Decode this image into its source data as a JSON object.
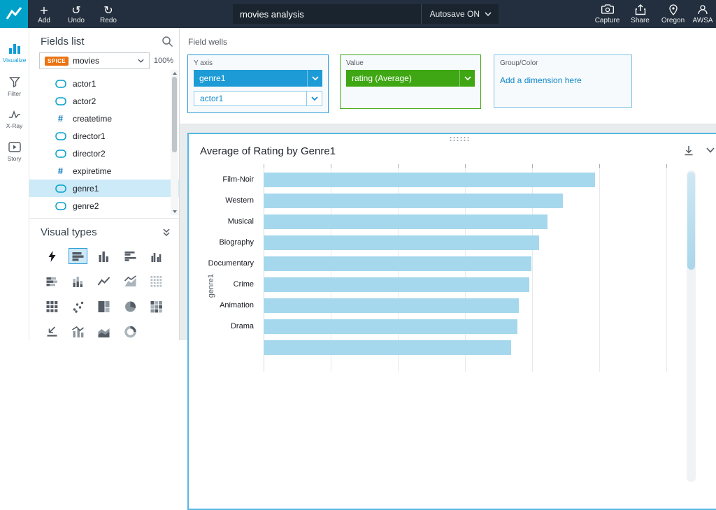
{
  "colors": {
    "accent_blue": "#1d9bd6",
    "accent_green": "#3ea713",
    "bar_fill": "#a5d8ec",
    "spice_badge": "#ec7211",
    "logo_teal": "#00a1c9",
    "link_blue": "#0f87c9"
  },
  "header": {
    "actions": [
      {
        "id": "add",
        "label": "Add"
      },
      {
        "id": "undo",
        "label": "Undo"
      },
      {
        "id": "redo",
        "label": "Redo"
      }
    ],
    "analysis_title": "movies analysis",
    "autosave_label": "Autosave ON",
    "right_actions": [
      {
        "id": "capture",
        "label": "Capture"
      },
      {
        "id": "share",
        "label": "Share"
      },
      {
        "id": "region",
        "label": "Oregon"
      },
      {
        "id": "account",
        "label": "AWSA"
      }
    ]
  },
  "nav_rail": {
    "items": [
      {
        "id": "visualize",
        "label": "Visualize",
        "active": true
      },
      {
        "id": "filter",
        "label": "Filter",
        "active": false
      },
      {
        "id": "xray",
        "label": "X-Ray",
        "active": false
      },
      {
        "id": "story",
        "label": "Story",
        "active": false
      }
    ]
  },
  "fields_panel": {
    "title": "Fields list",
    "dataset_badge": "SPICE",
    "dataset_name": "movies",
    "zoom_level": "100%",
    "fields": [
      {
        "name": "actor1",
        "type": "dimension"
      },
      {
        "name": "actor2",
        "type": "dimension"
      },
      {
        "name": "createtime",
        "type": "numeric"
      },
      {
        "name": "director1",
        "type": "dimension"
      },
      {
        "name": "director2",
        "type": "dimension"
      },
      {
        "name": "expiretime",
        "type": "numeric"
      },
      {
        "name": "genre1",
        "type": "dimension",
        "selected": true
      },
      {
        "name": "genre2",
        "type": "dimension"
      }
    ],
    "visual_types_title": "Visual types",
    "visual_types": [
      {
        "name": "auto-graph"
      },
      {
        "name": "horizontal-bar-chart",
        "selected": true
      },
      {
        "name": "vertical-bar-chart"
      },
      {
        "name": "horizontal-grouped-bar"
      },
      {
        "name": "vertical-grouped-bar"
      },
      {
        "name": "horizontal-stacked-bar"
      },
      {
        "name": "vertical-stacked-bar"
      },
      {
        "name": "line-chart"
      },
      {
        "name": "area-line-chart"
      },
      {
        "name": "pivot-table-light"
      },
      {
        "name": "pivot-table"
      },
      {
        "name": "scatter-plot"
      },
      {
        "name": "tree-map"
      },
      {
        "name": "pie-chart"
      },
      {
        "name": "heat-map"
      },
      {
        "name": "kpi"
      },
      {
        "name": "combo-bar-line"
      },
      {
        "name": "stacked-area"
      },
      {
        "name": "gauge"
      }
    ]
  },
  "field_wells": {
    "label": "Field wells",
    "y_axis": {
      "label": "Y axis",
      "primary": "genre1",
      "secondary": "actor1"
    },
    "value": {
      "label": "Value",
      "selection": "rating (Average)"
    },
    "group_color": {
      "label": "Group/Color",
      "placeholder": "Add a dimension here"
    }
  },
  "chart_data": {
    "type": "bar",
    "orientation": "horizontal",
    "title": "Average of Rating by Genre1",
    "xlabel": "",
    "ylabel": "genre1",
    "categories": [
      "Film-Noir",
      "Western",
      "Musical",
      "Biography",
      "Documentary",
      "Crime",
      "Animation",
      "Drama"
    ],
    "values": [
      7.9,
      7.14,
      6.77,
      6.56,
      6.39,
      6.33,
      6.08,
      6.05
    ],
    "partial_next_value": 5.9,
    "axis_max": 10,
    "grid_step": 1.6,
    "grid": true,
    "legend": false
  }
}
